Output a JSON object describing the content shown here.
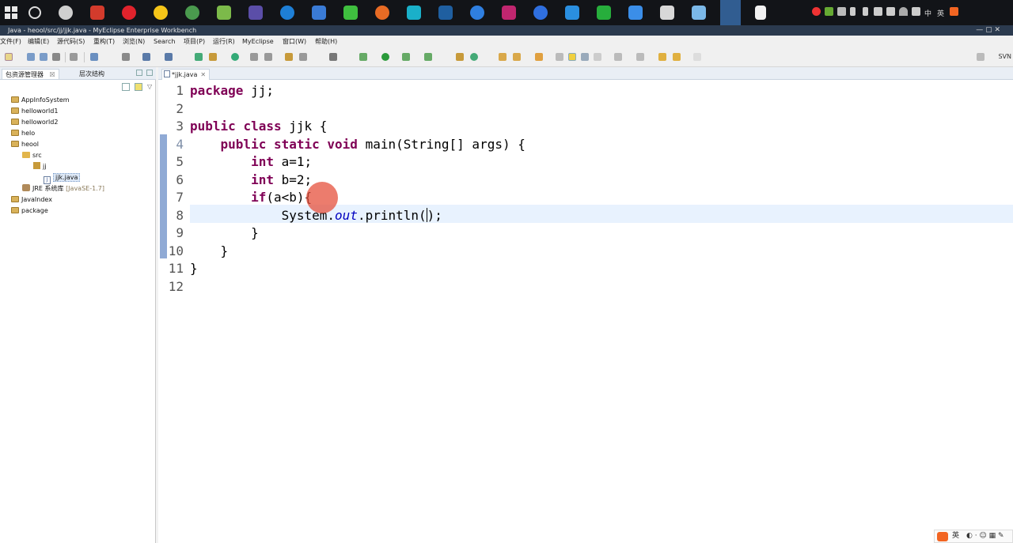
{
  "window": {
    "title": "Java - heool/src/jj/jjk.java - MyEclipse Enterprise Workbench",
    "controls": "—   ▢   ✕"
  },
  "tray": {
    "lang": "中",
    "ime": "英"
  },
  "menu": [
    "文件(F)",
    "编辑(E)",
    "源代码(S)",
    "重构(T)",
    "浏览(N)",
    "Search",
    "项目(P)",
    "运行(R)",
    "MyEclipse",
    "窗口(W)",
    "帮助(H)"
  ],
  "toolbar": {
    "svn_label": "SVN"
  },
  "explorer": {
    "tab_active": "包资源管理器",
    "tab_close": "☒",
    "tab_other": "层次结构",
    "tree": [
      {
        "label": "AppInfoSystem",
        "level": 0,
        "type": "project"
      },
      {
        "label": "helloworld1",
        "level": 0,
        "type": "project"
      },
      {
        "label": "helloworld2",
        "level": 0,
        "type": "project"
      },
      {
        "label": "helo",
        "level": 0,
        "type": "project"
      },
      {
        "label": "heool",
        "level": 0,
        "type": "project"
      },
      {
        "label": "src",
        "level": 1,
        "type": "src"
      },
      {
        "label": "jj",
        "level": 2,
        "type": "package"
      },
      {
        "label": "jjk.java",
        "level": 3,
        "type": "file"
      },
      {
        "label": "JRE 系统库",
        "level": 1,
        "type": "jre",
        "suffix": "[JavaSE-1.7]"
      },
      {
        "label": "JavaIndex",
        "level": 0,
        "type": "project"
      },
      {
        "label": "package",
        "level": 0,
        "type": "project"
      }
    ]
  },
  "editor": {
    "tab_label": "*jjk.java",
    "tab_close": "✕",
    "line_numbers": [
      "1",
      "2",
      "3",
      "4",
      "5",
      "6",
      "7",
      "8",
      "9",
      "10",
      "11",
      "12"
    ],
    "code": {
      "l1_kw": "package",
      "l1_rest": " jj;",
      "l3_kw1": "public",
      "l3_kw2": "class",
      "l3_rest": " jjk {",
      "l4_kw1": "public",
      "l4_kw2": "static",
      "l4_kw3": "void",
      "l4_rest": " main(String[] args) {",
      "l5_kw": "int",
      "l5_rest": " a=1;",
      "l6_kw": "int",
      "l6_rest": " b=2;",
      "l7_kw": "if",
      "l7_rest": "(a<b){",
      "l8_a": "System.",
      "l8_it": "out",
      "l8_b": ".println(",
      "l8_c": ")",
      "l8_d": ";",
      "l9": "}",
      "l10": "}",
      "l11": "}"
    }
  },
  "colors": {
    "keyword": "#7f0055",
    "static_field": "#0000c0",
    "current_line": "#e8f2fe",
    "click_indicator": "#e6503c"
  }
}
